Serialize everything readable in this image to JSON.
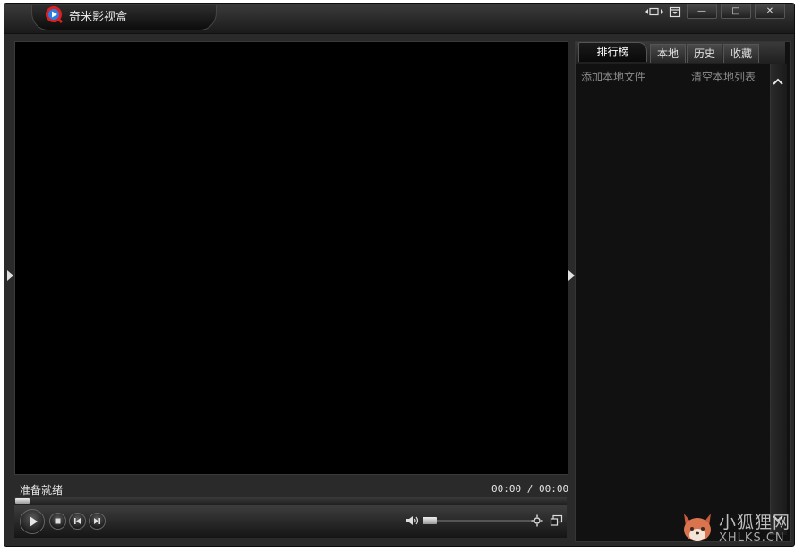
{
  "app": {
    "title": "奇米影视盒"
  },
  "window_controls": {
    "minimize_label": "—",
    "maximize_label": "□",
    "close_label": "✕"
  },
  "player": {
    "status": "准备就绪",
    "time": "00:00 / 00:00"
  },
  "panel": {
    "tabs": [
      {
        "label": "排行榜"
      },
      {
        "label": "本地"
      },
      {
        "label": "历史"
      },
      {
        "label": "收藏"
      }
    ],
    "add_local_label": "添加本地文件",
    "clear_local_label": "清空本地列表"
  },
  "watermark": {
    "cn": "小狐狸网",
    "en": "XHLKS.CN"
  },
  "colors": {
    "window_bg": "#2a2a2a",
    "video_bg": "#000000",
    "text": "#e6e6e6",
    "logo_red": "#e02020",
    "logo_blue": "#2a7de1"
  },
  "icons": {
    "logo": "qvod-logo-icon",
    "miniplayer": "mini-mode-icon",
    "skin": "skin-icon",
    "play": "play-icon",
    "stop": "stop-icon",
    "prev": "previous-icon",
    "next": "next-icon",
    "volume": "volume-icon",
    "settings": "settings-icon",
    "fullscreen": "fullscreen-icon"
  }
}
